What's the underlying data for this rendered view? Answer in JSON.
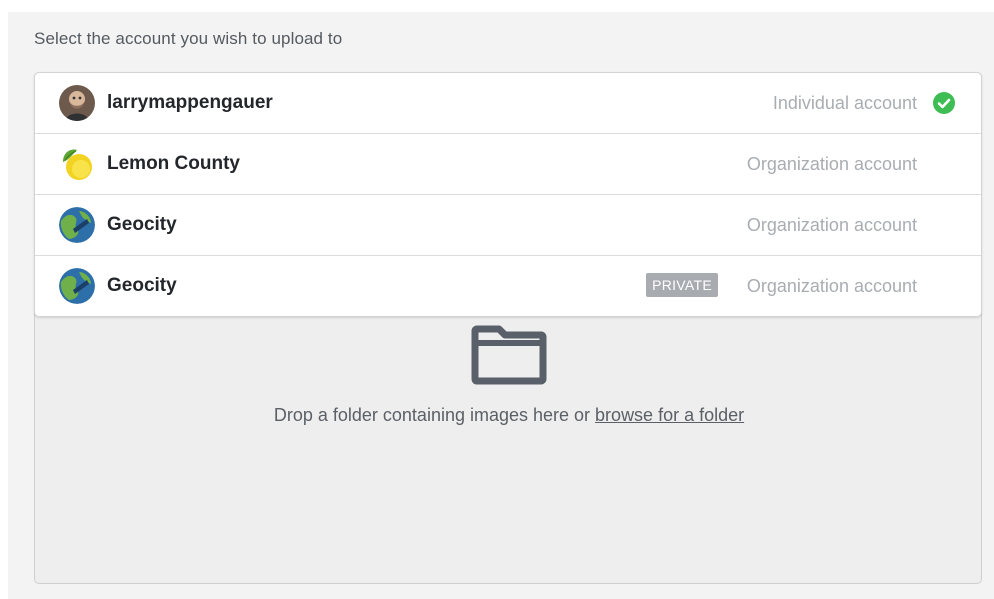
{
  "heading": "Select the account you wish to upload to",
  "accounts": [
    {
      "name": "larrymappengauer",
      "type": "Individual account",
      "avatar": "user-photo",
      "selected": true,
      "private": false
    },
    {
      "name": "Lemon County",
      "type": "Organization account",
      "avatar": "lemon-logo",
      "selected": false,
      "private": false
    },
    {
      "name": "Geocity",
      "type": "Organization account",
      "avatar": "globe-logo",
      "selected": false,
      "private": false
    },
    {
      "name": "Geocity",
      "type": "Organization account",
      "avatar": "globe-logo",
      "selected": false,
      "private": true,
      "badge": "PRIVATE"
    }
  ],
  "dropzone": {
    "icon": "folder-icon",
    "text": "Drop a folder containing images here or ",
    "link": "browse for a folder"
  },
  "colors": {
    "selected_check": "#3fbd55",
    "badge_bg": "#a8acb0"
  }
}
